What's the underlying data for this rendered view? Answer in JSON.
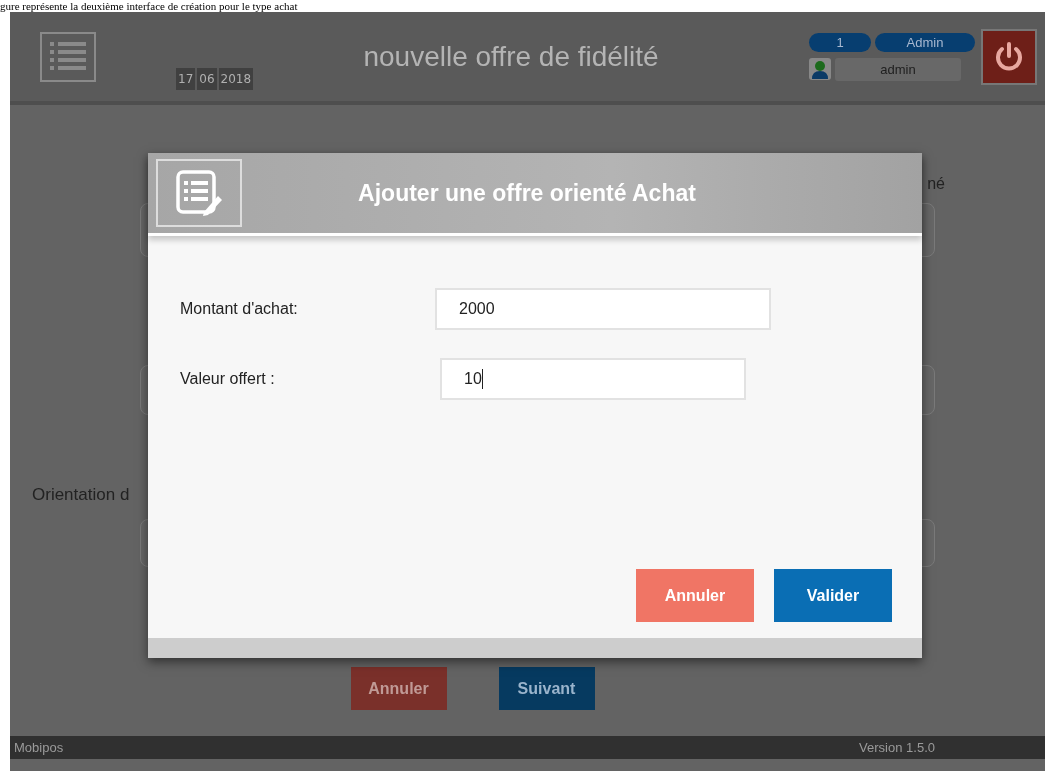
{
  "caption": "gure représente la deuxième interface de création pour le type achat",
  "header": {
    "date": [
      "17",
      "06",
      "2018"
    ],
    "title": "nouvelle offre de fidélité",
    "count": "1",
    "role": "Admin",
    "user": "admin"
  },
  "background": {
    "label_right": "né",
    "label_left": "Orientation d",
    "buttons": [
      {
        "label": "Annuler",
        "kind": "cancel"
      },
      {
        "label": "Suivant",
        "kind": "primary"
      }
    ]
  },
  "status_bar": {
    "app": "Mobipos",
    "version": "Version 1.5.0"
  },
  "modal": {
    "title": "Ajouter une offre orienté Achat",
    "fields": [
      {
        "label": "Montant d'achat:",
        "value": "2000",
        "focused": false
      },
      {
        "label": "Valeur offert :",
        "value": "10",
        "focused": true
      }
    ],
    "buttons": [
      {
        "label": "Annuler",
        "kind": "cancel"
      },
      {
        "label": "Valider",
        "kind": "primary"
      }
    ]
  }
}
